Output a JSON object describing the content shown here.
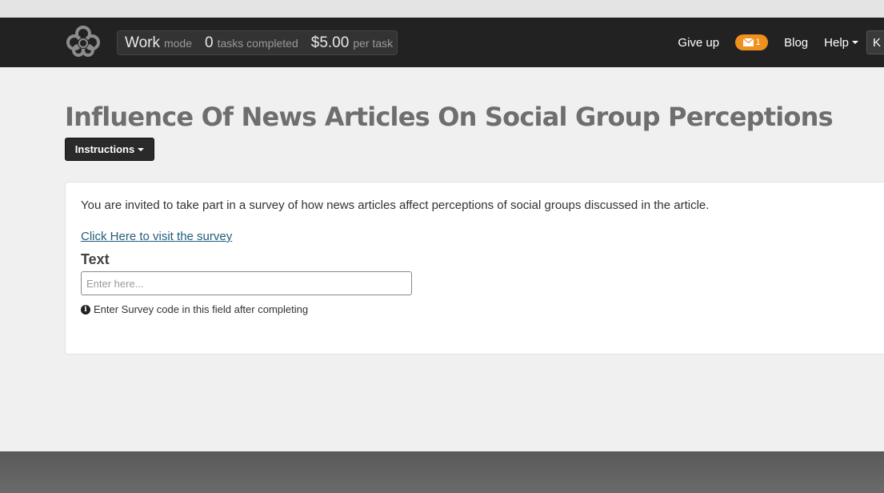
{
  "navbar": {
    "stats": {
      "mode_value": "Work",
      "mode_label": "mode",
      "tasks_value": "0",
      "tasks_label": "tasks completed",
      "price_value": "$5.00",
      "price_label": "per task"
    },
    "links": {
      "give_up": "Give up",
      "mail_count": "1",
      "blog": "Blog",
      "help": "Help",
      "user_initial": "K"
    }
  },
  "page": {
    "title": "Influence Of News Articles On Social Group Perceptions",
    "instructions_label": "Instructions"
  },
  "task": {
    "intro": "You are invited to take part in a survey of how news articles affect perceptions of social groups discussed in the article.",
    "survey_link": "Click Here to visit the survey",
    "field_label": "Text",
    "input_value": "",
    "input_placeholder": "Enter here...",
    "hint": "Enter Survey code in this field after completing"
  },
  "colors": {
    "navbar": "#222222",
    "badge": "#f0901e",
    "link": "#1f5d7a",
    "title": "#6e6e6e"
  }
}
